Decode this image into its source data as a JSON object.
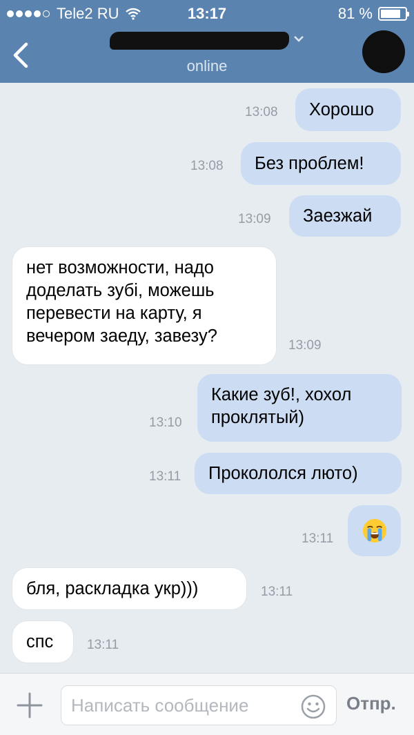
{
  "status_bar": {
    "carrier": "Tele2 RU",
    "time": "13:17",
    "battery": "81 %",
    "battery_level": 0.81,
    "signal_bars": 4
  },
  "header": {
    "back_icon": "chevron-left-icon",
    "contact_name": "",
    "status": "online"
  },
  "messages": [
    {
      "dir": "out",
      "text": "Хорошо",
      "time": "13:08"
    },
    {
      "dir": "out",
      "text": "Без проблем!",
      "time": "13:08"
    },
    {
      "dir": "out",
      "text": "Заезжай",
      "time": "13:09"
    },
    {
      "dir": "in",
      "lines": [
        "нет возможности, надо",
        "доделать зубі, можешь",
        "перевести на карту, я",
        "вечером заеду, завезу?"
      ],
      "time": "13:09"
    },
    {
      "dir": "out",
      "lines": [
        "Какие зуб!, хохол",
        "проклятый)"
      ],
      "time": "13:10"
    },
    {
      "dir": "out",
      "text": "Прокололся люто)",
      "time": "13:11"
    },
    {
      "dir": "out",
      "emoji": "loudly-crying-face-emoji",
      "time": "13:11"
    },
    {
      "dir": "in",
      "text": "бля, раскладка укр)))",
      "time": "13:11"
    },
    {
      "dir": "in",
      "text": "спс",
      "time": "13:11"
    }
  ],
  "input_bar": {
    "attach_icon": "plus-icon",
    "placeholder": "Написать сообщение",
    "value": "",
    "emoji_icon": "smile-icon",
    "send_label": "Отпр."
  },
  "colors": {
    "header_bg": "#5b83af",
    "chat_bg": "#e7ecf1",
    "outgoing_bubble": "#cbdcf3",
    "incoming_bubble": "#ffffff",
    "timestamp": "#949ca6"
  }
}
